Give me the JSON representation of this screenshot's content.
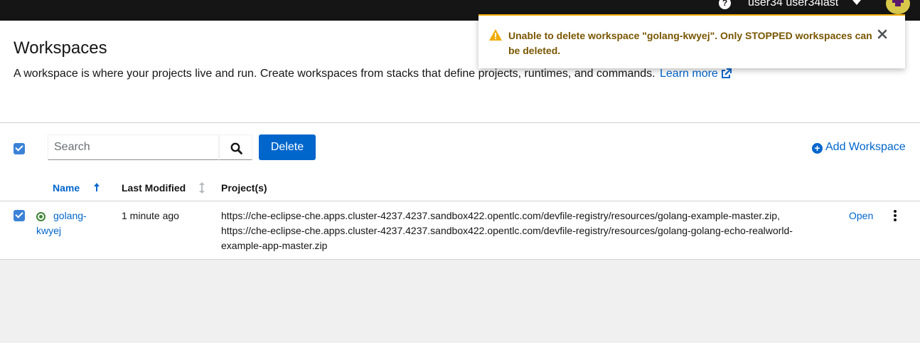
{
  "header": {
    "help_icon": "question-circle-icon",
    "help_glyph": "?",
    "user_name": "user34 user34last"
  },
  "page": {
    "title": "Workspaces",
    "description": "A workspace is where your projects live and run. Create workspaces from stacks that define projects, runtimes, and commands.",
    "learn_more": "Learn more"
  },
  "toolbar": {
    "search_placeholder": "Search",
    "search_value": "",
    "delete_label": "Delete",
    "add_workspace_label": "Add Workspace"
  },
  "table": {
    "columns": {
      "name": "Name",
      "last_modified": "Last Modified",
      "projects": "Project(s)"
    },
    "rows": [
      {
        "selected": true,
        "status": "running",
        "name_line1": "golang-",
        "name_line2": "kwyej",
        "last_modified": "1 minute ago",
        "project_lines": [
          "https://che-eclipse-che.apps.cluster-4237.4237.sandbox422.opentlc.com/devfile-registry/resources/golang-example-master.zip,",
          "https://che-eclipse-che.apps.cluster-4237.4237.sandbox422.opentlc.com/devfile-registry/resources/golang-golang-echo-realworld-",
          "example-app-master.zip"
        ],
        "action": "Open"
      }
    ]
  },
  "alert": {
    "severity": "warning",
    "line1": "Unable to delete workspace \"golang-kwyej\". Only STOPPED workspaces can",
    "line2": "be deleted."
  },
  "colors": {
    "masthead": "#151515",
    "link": "#0066cc",
    "primary_button": "#0066cc",
    "warning": "#f0ab00",
    "warning_text": "#795600",
    "status_running": "#3e8635"
  }
}
